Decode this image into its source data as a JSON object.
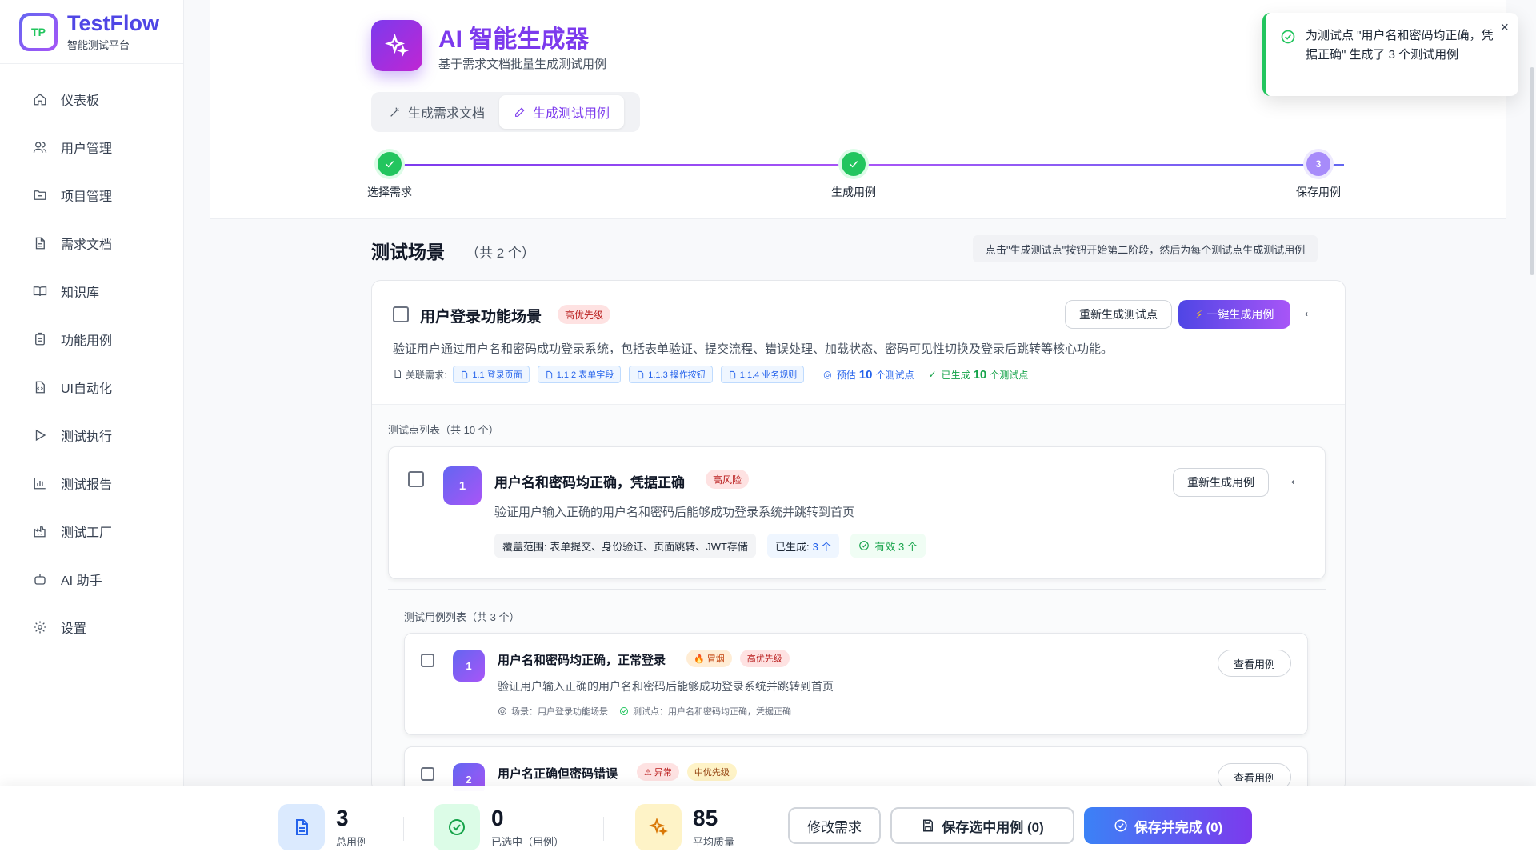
{
  "brand": {
    "logo_text": "TP",
    "title": "TestFlow",
    "subtitle": "智能测试平台"
  },
  "sidebar": {
    "items": [
      {
        "label": "仪表板",
        "icon": "home-icon"
      },
      {
        "label": "用户管理",
        "icon": "users-icon"
      },
      {
        "label": "项目管理",
        "icon": "folder-icon"
      },
      {
        "label": "需求文档",
        "icon": "document-icon"
      },
      {
        "label": "知识库",
        "icon": "book-icon"
      },
      {
        "label": "功能用例",
        "icon": "clipboard-icon"
      },
      {
        "label": "UI自动化",
        "icon": "code-file-icon"
      },
      {
        "label": "测试执行",
        "icon": "play-icon"
      },
      {
        "label": "测试报告",
        "icon": "bar-chart-icon"
      },
      {
        "label": "测试工厂",
        "icon": "factory-icon"
      },
      {
        "label": "AI 助手",
        "icon": "bot-icon"
      },
      {
        "label": "设置",
        "icon": "gear-icon"
      }
    ]
  },
  "header": {
    "title": "AI 智能生成器",
    "subtitle": "基于需求文档批量生成测试用例",
    "tabs": [
      {
        "label": "生成需求文档",
        "active": false
      },
      {
        "label": "生成测试用例",
        "active": true
      }
    ],
    "steps": [
      {
        "label": "选择需求",
        "status": "done"
      },
      {
        "label": "生成用例",
        "status": "done"
      },
      {
        "label": "保存用例",
        "status": "current",
        "number": "3"
      }
    ]
  },
  "section": {
    "title": "测试场景",
    "count": "（共 2 个）",
    "hint": "点击\"生成测试点\"按钮开始第二阶段，然后为每个测试点生成测试用例"
  },
  "scenario": {
    "title": "用户登录功能场景",
    "priority": "高优先级",
    "regenerate_label": "重新生成测试点",
    "generate_all_label": "一键生成用例",
    "collapse_glyph": "←",
    "description": "验证用户通过用户名和密码成功登录系统，包括表单验证、提交流程、错误处理、加载状态、密码可见性切换及登录后跳转等核心功能。",
    "req_label": "关联需求:",
    "requirements": [
      "1.1 登录页面",
      "1.1.2 表单字段",
      "1.1.3 操作按钮",
      "1.1.4 业务规则"
    ],
    "estimate_prefix": "预估",
    "estimate_value": "10",
    "estimate_suffix": "个测试点",
    "generated_prefix": "已生成",
    "generated_value": "10",
    "generated_suffix": "个测试点",
    "test_points_label": "测试点列表（共 10 个）"
  },
  "test_point": {
    "number": "1",
    "title": "用户名和密码均正确，凭据正确",
    "risk": "高风险",
    "regenerate_label": "重新生成用例",
    "collapse_glyph": "←",
    "description": "验证用户输入正确的用户名和密码后能够成功登录系统并跳转到首页",
    "coverage": "覆盖范围: 表单提交、身份验证、页面跳转、JWT存储",
    "generated_label": "已生成:",
    "generated_value": "3 个",
    "valid": "有效 3 个",
    "cases_label": "测试用例列表（共 3 个）"
  },
  "test_cases": [
    {
      "number": "1",
      "title": "用户名和密码均正确，正常登录",
      "type": "冒烟",
      "type_glyph": "🔥",
      "priority": "高优先级",
      "description": "验证用户输入正确的用户名和密码后能够成功登录系统并跳转到首页",
      "scenario": "场景：用户登录功能场景",
      "test_point": "测试点：用户名和密码均正确，凭据正确",
      "view_label": "查看用例"
    },
    {
      "number": "2",
      "title": "用户名正确但密码错误",
      "type": "异常",
      "type_glyph": "⚠",
      "priority": "中优先级",
      "view_label": "查看用例"
    }
  ],
  "bottom": {
    "stats": [
      {
        "value": "3",
        "label": "总用例",
        "icon": "document-icon"
      },
      {
        "value": "0",
        "label": "已选中（用例）",
        "icon": "check-circle-icon"
      },
      {
        "value": "85",
        "label": "平均质量",
        "icon": "sparkles-icon"
      }
    ],
    "edit_label": "修改需求",
    "save_selected_label": "保存选中用例 (0)",
    "save_finish_label": "保存并完成 (0)"
  },
  "toast": {
    "message": "为测试点 \"用户名和密码均正确，凭据正确\" 生成了 3 个测试用例",
    "close_glyph": "×"
  },
  "colors": {
    "accent": "#7c3aed",
    "brand": "#4f46e5",
    "success": "#22c55e",
    "danger": "#b91c1c"
  }
}
